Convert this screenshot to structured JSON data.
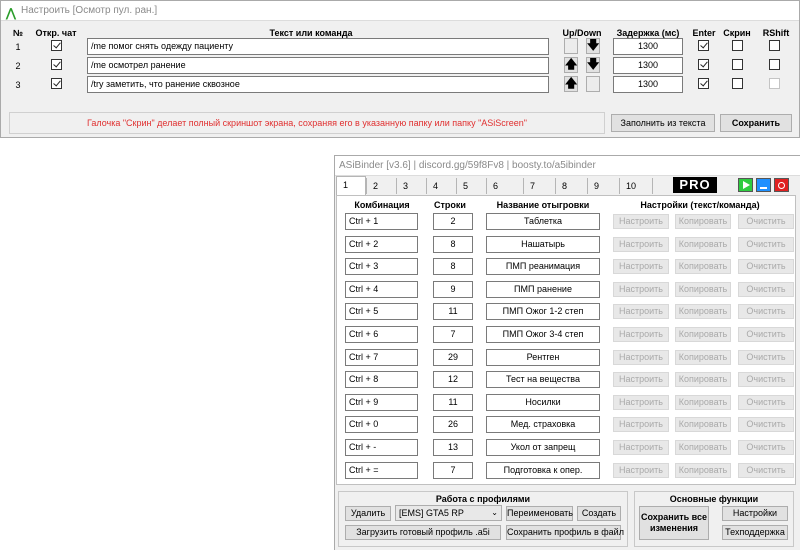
{
  "window1": {
    "title": "Настроить [Осмотр пул. ран.]",
    "headers": {
      "no": "№",
      "open_chat": "Откр. чат",
      "text": "Текст или команда",
      "updown": "Up/Down",
      "delay": "Задержка (мс)",
      "enter": "Enter",
      "screen": "Скрин",
      "rshift": "RShift"
    },
    "rows": [
      {
        "no": "1",
        "open_chat": true,
        "text": "/me помог снять одежду пациенту",
        "up": "",
        "down": "🡇",
        "delay": "1300",
        "enter": true,
        "screen": false,
        "rshift": false
      },
      {
        "no": "2",
        "open_chat": true,
        "text": "/me осмотрел ранение",
        "up": "🡅",
        "down": "🡇",
        "delay": "1300",
        "enter": true,
        "screen": false,
        "rshift": false
      },
      {
        "no": "3",
        "open_chat": true,
        "text": "/try заметить, что ранение сквозное",
        "up": "🡅",
        "down": "",
        "delay": "1300",
        "enter": true,
        "screen": false,
        "rshift": false
      }
    ],
    "hint": "Галочка \"Скрин\" делает полный скриншот экрана, сохраняя его в указанную папку или папку \"ASiScreen\"",
    "fill_from_text": "Заполнить из текста",
    "save": "Сохранить",
    "hint_color": "#e03030"
  },
  "window2": {
    "title": "ASiBinder [v3.6]  |  discord.gg/59f8Fv8  |  boosty.to/a5ibinder",
    "tabs": [
      "1",
      "2",
      "3",
      "4",
      "5",
      "6",
      "7",
      "8",
      "9",
      "10"
    ],
    "pro_label": "PRO",
    "headers": {
      "combo": "Комбинация",
      "lines": "Строки",
      "name": "Название отыгровки",
      "settings": "Настройки (текст/команда)"
    },
    "row_buttons": {
      "configure": "Настроить",
      "copy": "Копировать",
      "clear": "Очистить"
    },
    "rows": [
      {
        "combo": "Ctrl + 1",
        "lines": "2",
        "name": "Таблетка"
      },
      {
        "combo": "Ctrl + 2",
        "lines": "8",
        "name": "Нашатырь"
      },
      {
        "combo": "Ctrl + 3",
        "lines": "8",
        "name": "ПМП реанимация"
      },
      {
        "combo": "Ctrl + 4",
        "lines": "9",
        "name": "ПМП ранение"
      },
      {
        "combo": "Ctrl + 5",
        "lines": "11",
        "name": "ПМП Ожог 1-2 степ"
      },
      {
        "combo": "Ctrl + 6",
        "lines": "7",
        "name": "ПМП Ожог 3-4 степ"
      },
      {
        "combo": "Ctrl + 7",
        "lines": "29",
        "name": "Рентген"
      },
      {
        "combo": "Ctrl + 8",
        "lines": "12",
        "name": "Тест на вещества"
      },
      {
        "combo": "Ctrl + 9",
        "lines": "11",
        "name": "Носилки"
      },
      {
        "combo": "Ctrl + 0",
        "lines": "26",
        "name": "Мед. страховка"
      },
      {
        "combo": "Ctrl + -",
        "lines": "13",
        "name": "Укол от запрещ"
      },
      {
        "combo": "Ctrl + =",
        "lines": "7",
        "name": "Подготовка к опер."
      }
    ],
    "profiles": {
      "title": "Работа с профилями",
      "delete": "Удалить",
      "selected": "[EMS] GTA5 RP",
      "rename": "Переименовать",
      "create": "Создать",
      "load": "Загрузить готовый профиль .a5i",
      "save_file": "Сохранить профиль в файл"
    },
    "main": {
      "title": "Основные функции",
      "save_all": "Сохранить все изменения",
      "settings": "Настройки",
      "support": "Техподдержка"
    },
    "colors": {
      "play": "#2ecc40",
      "minimize": "#1e90ff",
      "close": "#e02020"
    }
  }
}
